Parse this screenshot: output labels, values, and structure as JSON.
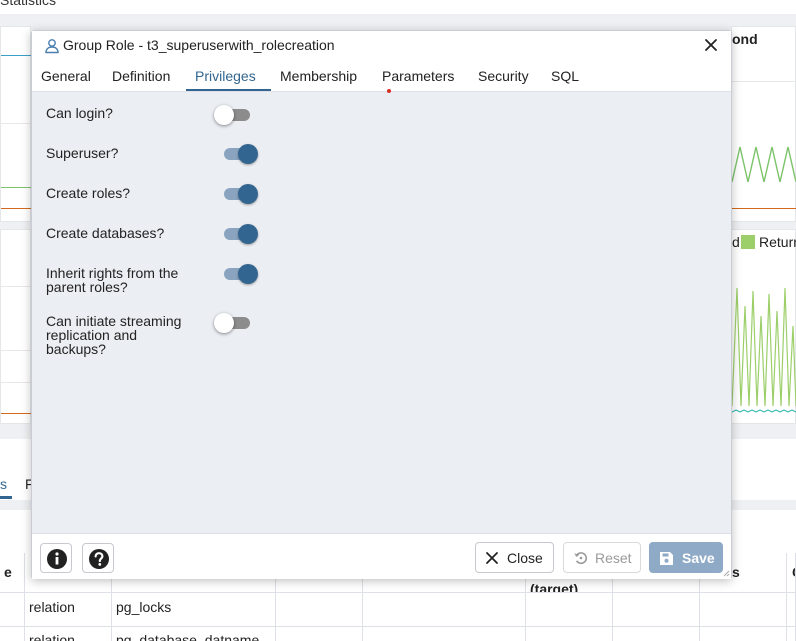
{
  "background": {
    "top_title": "Statistics",
    "panel_heading_right": "ond",
    "legend_fragment": "d",
    "legend_returned": "Returr",
    "legend_returned_color": "#9ccf6a",
    "tabs": [
      "s",
      "F"
    ],
    "table": {
      "headers": [
        "e",
        "",
        "",
        "",
        "",
        "(target)",
        "",
        "s",
        "C"
      ],
      "rows": [
        [
          "",
          "relation",
          "pg_locks",
          "",
          "",
          "",
          "",
          "",
          ""
        ],
        [
          "",
          "relation",
          "pg_database_datname",
          "",
          "",
          "",
          "",
          "",
          ""
        ]
      ]
    }
  },
  "dialog": {
    "title": "Group Role - t3_superuserwith_rolecreation",
    "tabs": [
      {
        "label": "General",
        "active": false
      },
      {
        "label": "Definition",
        "active": false
      },
      {
        "label": "Privileges",
        "active": true
      },
      {
        "label": "Membership",
        "active": false
      },
      {
        "label": "Parameters",
        "active": false
      },
      {
        "label": "Security",
        "active": false
      },
      {
        "label": "SQL",
        "active": false
      }
    ],
    "privileges": [
      {
        "label": "Can login?",
        "enabled": false
      },
      {
        "label": "Superuser?",
        "enabled": true
      },
      {
        "label": "Create roles?",
        "enabled": true
      },
      {
        "label": "Create databases?",
        "enabled": true
      },
      {
        "label": "Inherit rights from the parent roles?",
        "enabled": true
      },
      {
        "label": "Can initiate streaming replication and backups?",
        "enabled": false
      }
    ],
    "footer": {
      "info_icon": "info-icon",
      "help_icon": "help-icon",
      "close_label": "Close",
      "reset_label": "Reset",
      "save_label": "Save"
    },
    "colors": {
      "accent": "#326690",
      "save_button": "#8eaac6"
    }
  }
}
